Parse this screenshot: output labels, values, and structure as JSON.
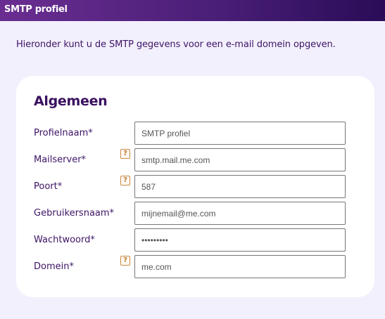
{
  "header": {
    "title": "SMTP profiel"
  },
  "intro_text": "Hieronder kunt u de SMTP gegevens voor een e-mail domein opgeven.",
  "section": {
    "title": "Algemeen",
    "help_glyph": "?",
    "fields": [
      {
        "label": "Profielnaam*",
        "value": "SMTP profiel",
        "has_help": false
      },
      {
        "label": "Mailserver*",
        "value": "smtp.mail.me.com",
        "has_help": true
      },
      {
        "label": "Poort*",
        "value": "587",
        "has_help": true
      },
      {
        "label": "Gebruikersnaam*",
        "value": "mijnemail@me.com",
        "has_help": false
      },
      {
        "label": "Wachtwoord*",
        "value": "•••••••••",
        "has_help": false,
        "type": "password"
      },
      {
        "label": "Domein*",
        "value": "me.com",
        "has_help": true
      }
    ]
  },
  "colors": {
    "header_gradient_start": "#6a2d91",
    "header_gradient_end": "#2a0c57",
    "page_background": "#f3f0fd",
    "label_text": "#3d1466",
    "help_icon": "#c07a30"
  }
}
